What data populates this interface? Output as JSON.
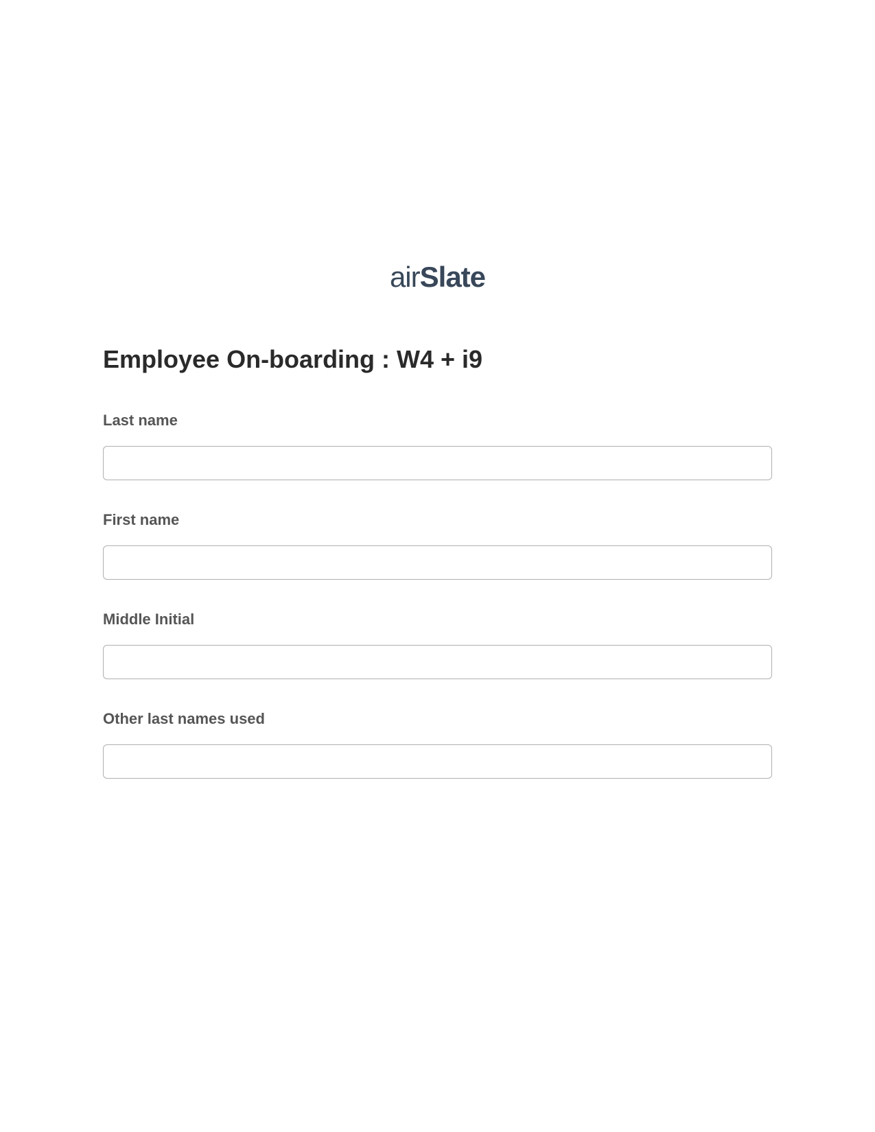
{
  "logo": {
    "air": "air",
    "slate": "Slate"
  },
  "form": {
    "title": "Employee On-boarding : W4 + i9",
    "fields": {
      "lastName": {
        "label": "Last name",
        "value": ""
      },
      "firstName": {
        "label": "First name",
        "value": ""
      },
      "middleInitial": {
        "label": "Middle Initial",
        "value": ""
      },
      "otherLastNames": {
        "label": "Other last names used",
        "value": ""
      }
    }
  }
}
